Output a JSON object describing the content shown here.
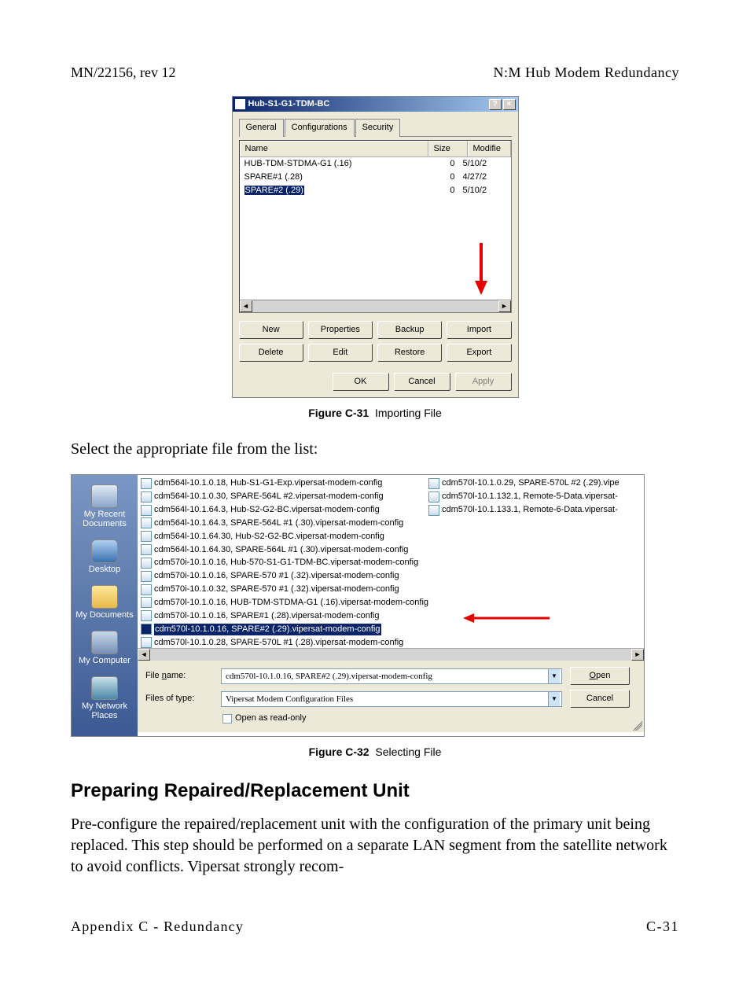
{
  "header": {
    "left": "MN/22156, rev 12",
    "right": "N:M Hub Modem Redundancy"
  },
  "dialog": {
    "title": "Hub-S1-G1-TDM-BC",
    "title_btn_help": "?",
    "title_btn_close": "×",
    "tabs": {
      "general": "General",
      "configs": "Configurations",
      "security": "Security"
    },
    "cols": {
      "name": "Name",
      "size": "Size",
      "mod": "Modifie"
    },
    "rows": [
      {
        "name": "HUB-TDM-STDMA-G1 (.16)",
        "size": "0",
        "mod": "5/10/2"
      },
      {
        "name": "SPARE#1 (.28)",
        "size": "0",
        "mod": "4/27/2"
      },
      {
        "name": "SPARE#2 (.29)",
        "size": "0",
        "mod": "5/10/2"
      }
    ],
    "scroll_left": "◄",
    "scroll_right": "►",
    "buttons": {
      "new": "New",
      "properties": "Properties",
      "backup": "Backup",
      "import": "Import",
      "delete": "Delete",
      "edit": "Edit",
      "restore": "Restore",
      "export": "Export",
      "ok": "OK",
      "cancel": "Cancel",
      "apply": "Apply"
    }
  },
  "fig1": {
    "label": "Figure C-31",
    "caption": "Importing File"
  },
  "between_text": "Select the appropriate file from the list:",
  "places": {
    "recent": "My Recent Documents",
    "desktop": "Desktop",
    "docs": "My Documents",
    "comp": "My Computer",
    "net": "My Network Places"
  },
  "files_left": [
    "cdm564l-10.1.0.18, Hub-S1-G1-Exp.vipersat-modem-config",
    "cdm564l-10.1.0.30, SPARE-564L #2.vipersat-modem-config",
    "cdm564l-10.1.64.3, Hub-S2-G2-BC.vipersat-modem-config",
    "cdm564l-10.1.64.3, SPARE-564L #1 (.30).vipersat-modem-config",
    "cdm564l-10.1.64.30, Hub-S2-G2-BC.vipersat-modem-config",
    "cdm564l-10.1.64.30, SPARE-564L #1 (.30).vipersat-modem-config",
    "cdm570i-10.1.0.16, Hub-570-S1-G1-TDM-BC.vipersat-modem-config",
    "cdm570i-10.1.0.16, SPARE-570 #1 (.32).vipersat-modem-config",
    "cdm570i-10.1.0.32, SPARE-570 #1 (.32).vipersat-modem-config",
    "cdm570l-10.1.0.16, HUB-TDM-STDMA-G1 (.16).vipersat-modem-config",
    "cdm570l-10.1.0.16, SPARE#1 (.28).vipersat-modem-config",
    "cdm570l-10.1.0.16, SPARE#2 (.29).vipersat-modem-config",
    "cdm570l-10.1.0.28, SPARE-570L #1 (.28).vipersat-modem-config"
  ],
  "files_right": [
    "cdm570l-10.1.0.29, SPARE-570L #2 (.29).vipe",
    "cdm570l-10.1.132.1, Remote-5-Data.vipersat-",
    "cdm570l-10.1.133.1, Remote-6-Data.vipersat-"
  ],
  "fb": {
    "fname_label_pre": "File ",
    "fname_label_u": "n",
    "fname_label_post": "ame:",
    "ftype_label": "Files of type:",
    "fname_value": "cdm570l-10.1.0.16, SPARE#2 (.29).vipersat-modem-config",
    "ftype_value": "Vipersat Modem Configuration Files",
    "open_u": "O",
    "open_rest": "pen",
    "cancel": "Cancel",
    "readonly": "Open as read-only"
  },
  "fig2": {
    "label": "Figure C-32",
    "caption": "Selecting File"
  },
  "section": "Preparing Repaired/Replacement Unit",
  "para": "Pre-configure the repaired/replacement unit with the configuration of the primary unit being replaced. This step should be performed on a separate LAN segment from the satellite network to avoid conflicts. Vipersat strongly recom-",
  "footer": {
    "left": "Appendix C - Redundancy",
    "right": "C-31"
  }
}
